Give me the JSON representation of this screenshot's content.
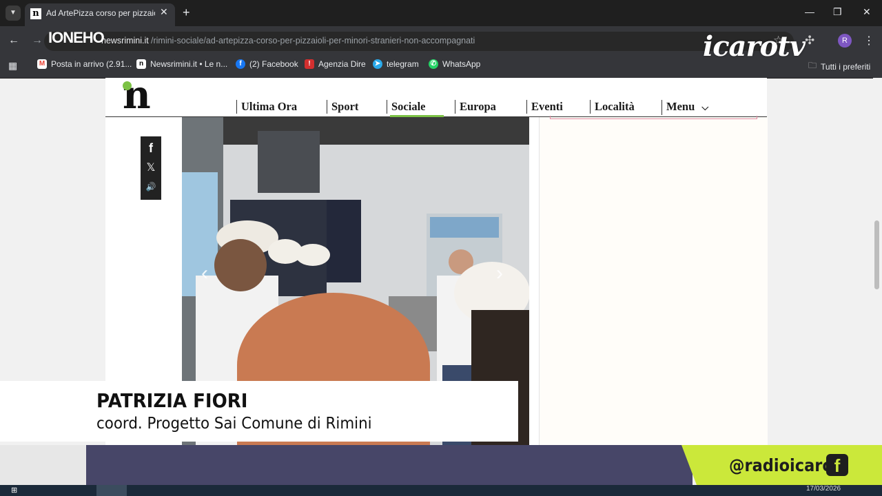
{
  "browser": {
    "tab_title": "Ad ArtePizza corso per pizzaioli",
    "tab_favicon": "n",
    "url_domain": "newsrimini.it",
    "url_path": "/rimini-sociale/ad-artepizza-corso-per-pizzaioli-per-minori-stranieri-non-accompagnati",
    "profile_initial": "R",
    "overlay_text": "IONEHO"
  },
  "bookmarks": [
    {
      "label": "Posta in arrivo (2.91...",
      "icon": "gmail-icon",
      "color": "#ea4335",
      "glyph": "M"
    },
    {
      "label": "Newsrimini.it • Le n...",
      "icon": "newsrimini-icon",
      "color": "#ffffff",
      "glyph": "n"
    },
    {
      "label": "(2) Facebook",
      "icon": "facebook-icon",
      "color": "#1877f2",
      "glyph": "f"
    },
    {
      "label": "Agenzia Dire",
      "icon": "dire-icon",
      "color": "#d32f2f",
      "glyph": "!"
    },
    {
      "label": "telegram",
      "icon": "telegram-icon",
      "color": "#29a9eb",
      "glyph": "➤"
    },
    {
      "label": "WhatsApp",
      "icon": "whatsapp-icon",
      "color": "#25d366",
      "glyph": "✆"
    }
  ],
  "bookmarks_other": "Tutti i preferiti",
  "watermark": "icarotv",
  "site": {
    "logo": "n",
    "nav": [
      "Ultima Ora",
      "Sport",
      "Sociale",
      "Europa",
      "Eventi",
      "Località",
      "Menu"
    ],
    "active_nav": "Sociale",
    "accent": "#7cc245"
  },
  "share": {
    "facebook": "f",
    "x": "𝕏",
    "audio": "🔊"
  },
  "lower_third": {
    "name": "PATRIZIA FIORI",
    "role": "coord. Progetto Sai Comune di Rimini"
  },
  "social": {
    "handle": "@radioicaro",
    "icon": "facebook-icon"
  },
  "taskbar": {
    "date": "17/03/2026"
  }
}
